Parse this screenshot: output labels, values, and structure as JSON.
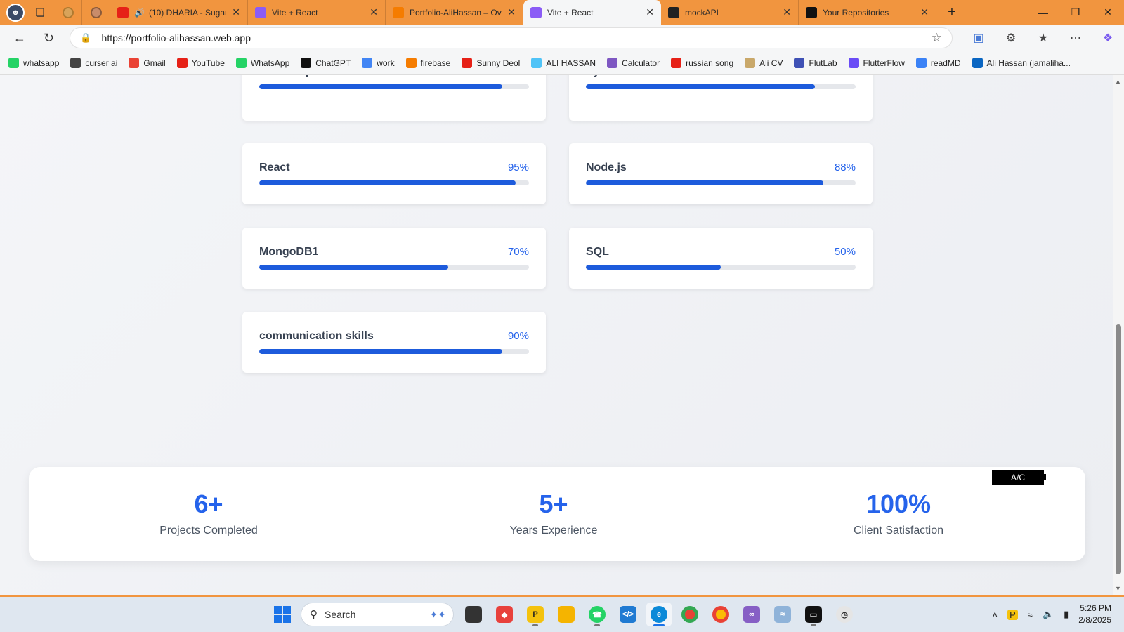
{
  "browser": {
    "tabs": [
      {
        "title": "(10) DHARIA - Sugar",
        "favicon": "youtube-icon",
        "color": "#e62117",
        "audio": true
      },
      {
        "title": "Vite + React",
        "favicon": "vite-icon",
        "color": "#8b5cf6"
      },
      {
        "title": "Portfolio-AliHassan – Ove",
        "favicon": "firebase-icon",
        "color": "#f57c00"
      },
      {
        "title": "Vite + React",
        "favicon": "vite-icon",
        "color": "#8b5cf6",
        "active": true
      },
      {
        "title": "mockAPI",
        "favicon": "mockapi-icon",
        "color": "#222"
      },
      {
        "title": "Your Repositories",
        "favicon": "github-icon",
        "color": "#111"
      }
    ],
    "url": "https://portfolio-alihassan.web.app",
    "bookmarks": [
      {
        "label": "whatsapp",
        "color": "#25d366"
      },
      {
        "label": "curser ai",
        "color": "#444"
      },
      {
        "label": "Gmail",
        "color": "#ea4335"
      },
      {
        "label": "YouTube",
        "color": "#e62117"
      },
      {
        "label": "WhatsApp",
        "color": "#25d366"
      },
      {
        "label": "ChatGPT",
        "color": "#111"
      },
      {
        "label": "work",
        "color": "#4285f4"
      },
      {
        "label": "firebase",
        "color": "#f57c00"
      },
      {
        "label": "Sunny Deol",
        "color": "#e62117"
      },
      {
        "label": "ALI HASSAN",
        "color": "#4fc3f7"
      },
      {
        "label": "Calculator",
        "color": "#7e57c2"
      },
      {
        "label": "russian song",
        "color": "#e62117"
      },
      {
        "label": "Ali CV",
        "color": "#c9a86a"
      },
      {
        "label": "FlutLab",
        "color": "#3f51b5"
      },
      {
        "label": "FlutterFlow",
        "color": "#6a4cf6"
      },
      {
        "label": "readMD",
        "color": "#3b82f6"
      },
      {
        "label": "Ali Hassan (jamaliha...",
        "color": "#0a66c2"
      }
    ]
  },
  "skills": [
    {
      "name": "JavaScript",
      "percent": "90%",
      "value": 90
    },
    {
      "name": "Python",
      "percent": "85%",
      "value": 85
    },
    {
      "name": "React",
      "percent": "95%",
      "value": 95
    },
    {
      "name": "Node.js",
      "percent": "88%",
      "value": 88
    },
    {
      "name": "MongoDB1",
      "percent": "70%",
      "value": 70
    },
    {
      "name": "SQL",
      "percent": "50%",
      "value": 50
    },
    {
      "name": "communication skills",
      "percent": "90%",
      "value": 90
    }
  ],
  "stats": [
    {
      "value": "6+",
      "label": "Projects Completed"
    },
    {
      "value": "5+",
      "label": "Years Experience"
    },
    {
      "value": "100%",
      "label": "Client Satisfaction"
    }
  ],
  "overlay_badge": "A/C",
  "taskbar": {
    "search_label": "Search",
    "time": "5:26 PM",
    "date": "2/8/2025"
  },
  "colors": {
    "accent": "#2563eb",
    "browser_frame": "#f1953f"
  }
}
